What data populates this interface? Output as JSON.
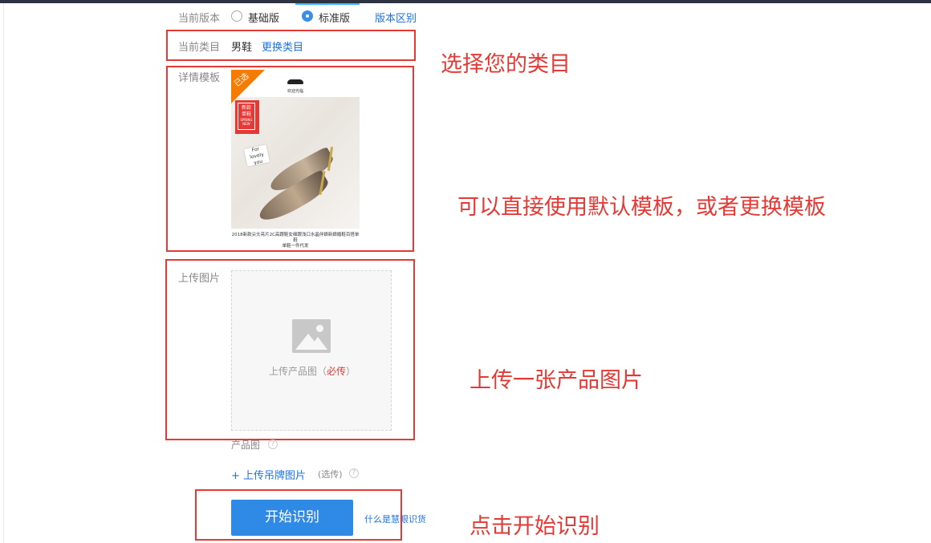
{
  "version": {
    "label": "当前版本",
    "options": [
      {
        "label": "基础版",
        "selected": false
      },
      {
        "label": "标准版",
        "selected": true
      }
    ],
    "diff_link": "版本区别"
  },
  "category": {
    "label": "当前类目",
    "value": "男鞋",
    "change_link": "更换类目"
  },
  "template": {
    "label": "详情模板",
    "badge": "已选",
    "welcome": "欢迎光临",
    "tag_lines": [
      "新款",
      "单鞋",
      "SPRING NEW"
    ],
    "card_lines": [
      "For lovely",
      "you"
    ],
    "caption_lines": [
      "2018新款尖头亮片2C高跟鞋女细跟浅口水晶伴娘新娘婚鞋百搭单鞋",
      "单鞋一件代发"
    ]
  },
  "upload": {
    "label": "上传图片",
    "hint_prefix": "上传产品图（",
    "hint_required": "必传",
    "hint_suffix": "）",
    "image_caption": "产品图",
    "hangtag_link": "+ 上传吊牌图片",
    "hangtag_optional": "(选传)"
  },
  "actions": {
    "start_button": "开始识别",
    "help_link": "什么是慧眼识货"
  },
  "annotations": {
    "choose_category": "选择您的类目",
    "template_tip": "可以直接使用默认模板，或者更换模板",
    "upload_tip": "上传一张产品图片",
    "start_tip": "点击开始识别"
  },
  "colors": {
    "annotation_red": "#e53935",
    "link_blue": "#1a73e8",
    "button_blue": "#2f8ae5",
    "badge_orange": "#f57c00"
  }
}
